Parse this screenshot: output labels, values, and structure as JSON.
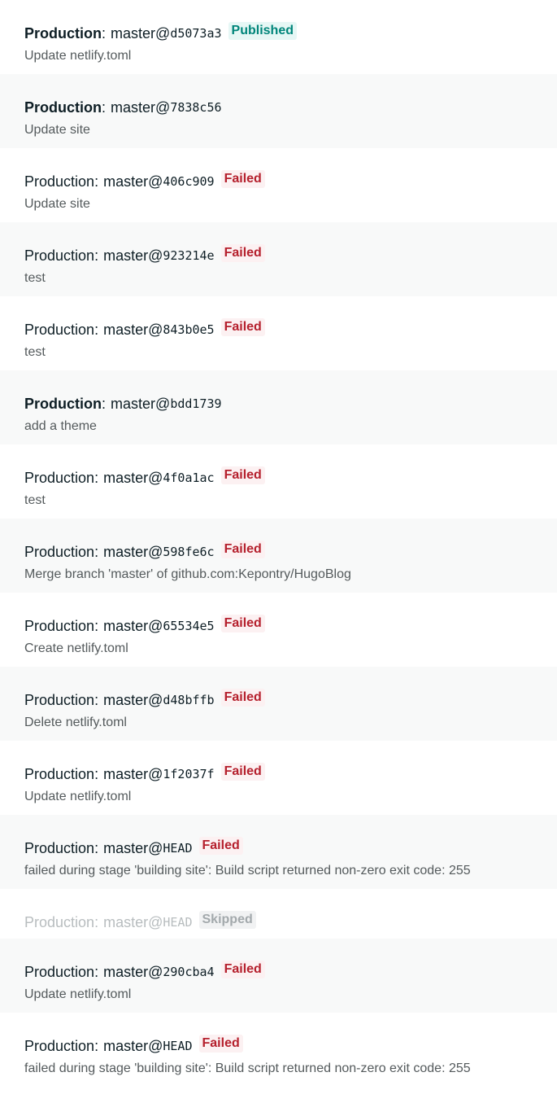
{
  "deploys": [
    {
      "context": "Production",
      "branch": "master@",
      "sha": "d5073a3",
      "status": "Published",
      "status_key": "published",
      "message": "Update netlify.toml",
      "bold": true
    },
    {
      "context": "Production",
      "branch": "master@",
      "sha": "7838c56",
      "status": "",
      "status_key": "",
      "message": "Update site",
      "bold": true
    },
    {
      "context": "Production",
      "branch": "master@",
      "sha": "406c909",
      "status": "Failed",
      "status_key": "failed",
      "message": "Update site",
      "bold": false
    },
    {
      "context": "Production",
      "branch": "master@",
      "sha": "923214e",
      "status": "Failed",
      "status_key": "failed",
      "message": "test",
      "bold": false
    },
    {
      "context": "Production",
      "branch": "master@",
      "sha": "843b0e5",
      "status": "Failed",
      "status_key": "failed",
      "message": "test",
      "bold": false
    },
    {
      "context": "Production",
      "branch": "master@",
      "sha": "bdd1739",
      "status": "",
      "status_key": "",
      "message": "add a theme",
      "bold": true
    },
    {
      "context": "Production",
      "branch": "master@",
      "sha": "4f0a1ac",
      "status": "Failed",
      "status_key": "failed",
      "message": "test",
      "bold": false
    },
    {
      "context": "Production",
      "branch": "master@",
      "sha": "598fe6c",
      "status": "Failed",
      "status_key": "failed",
      "message": "Merge branch 'master' of github.com:Kepontry/HugoBlog",
      "bold": false
    },
    {
      "context": "Production",
      "branch": "master@",
      "sha": "65534e5",
      "status": "Failed",
      "status_key": "failed",
      "message": "Create netlify.toml",
      "bold": false
    },
    {
      "context": "Production",
      "branch": "master@",
      "sha": "d48bffb",
      "status": "Failed",
      "status_key": "failed",
      "message": "Delete netlify.toml",
      "bold": false
    },
    {
      "context": "Production",
      "branch": "master@",
      "sha": "1f2037f",
      "status": "Failed",
      "status_key": "failed",
      "message": "Update netlify.toml",
      "bold": false
    },
    {
      "context": "Production",
      "branch": "master@",
      "sha": "HEAD",
      "status": "Failed",
      "status_key": "failed",
      "message": "failed during stage 'building site': Build script returned non-zero exit code: 255",
      "bold": false
    },
    {
      "context": "Production",
      "branch": "master@",
      "sha": "HEAD",
      "status": "Skipped",
      "status_key": "skipped",
      "message": "",
      "bold": false,
      "muted": true
    },
    {
      "context": "Production",
      "branch": "master@",
      "sha": "290cba4",
      "status": "Failed",
      "status_key": "failed",
      "message": "Update netlify.toml",
      "bold": false
    },
    {
      "context": "Production",
      "branch": "master@",
      "sha": "HEAD",
      "status": "Failed",
      "status_key": "failed",
      "message": "failed during stage 'building site': Build script returned non-zero exit code: 255",
      "bold": false
    }
  ],
  "colors": {
    "published": "#00857a",
    "failed": "#b5202d",
    "skipped": "#a3a9ac",
    "text": "#0e1e25",
    "message": "#545a5c"
  }
}
